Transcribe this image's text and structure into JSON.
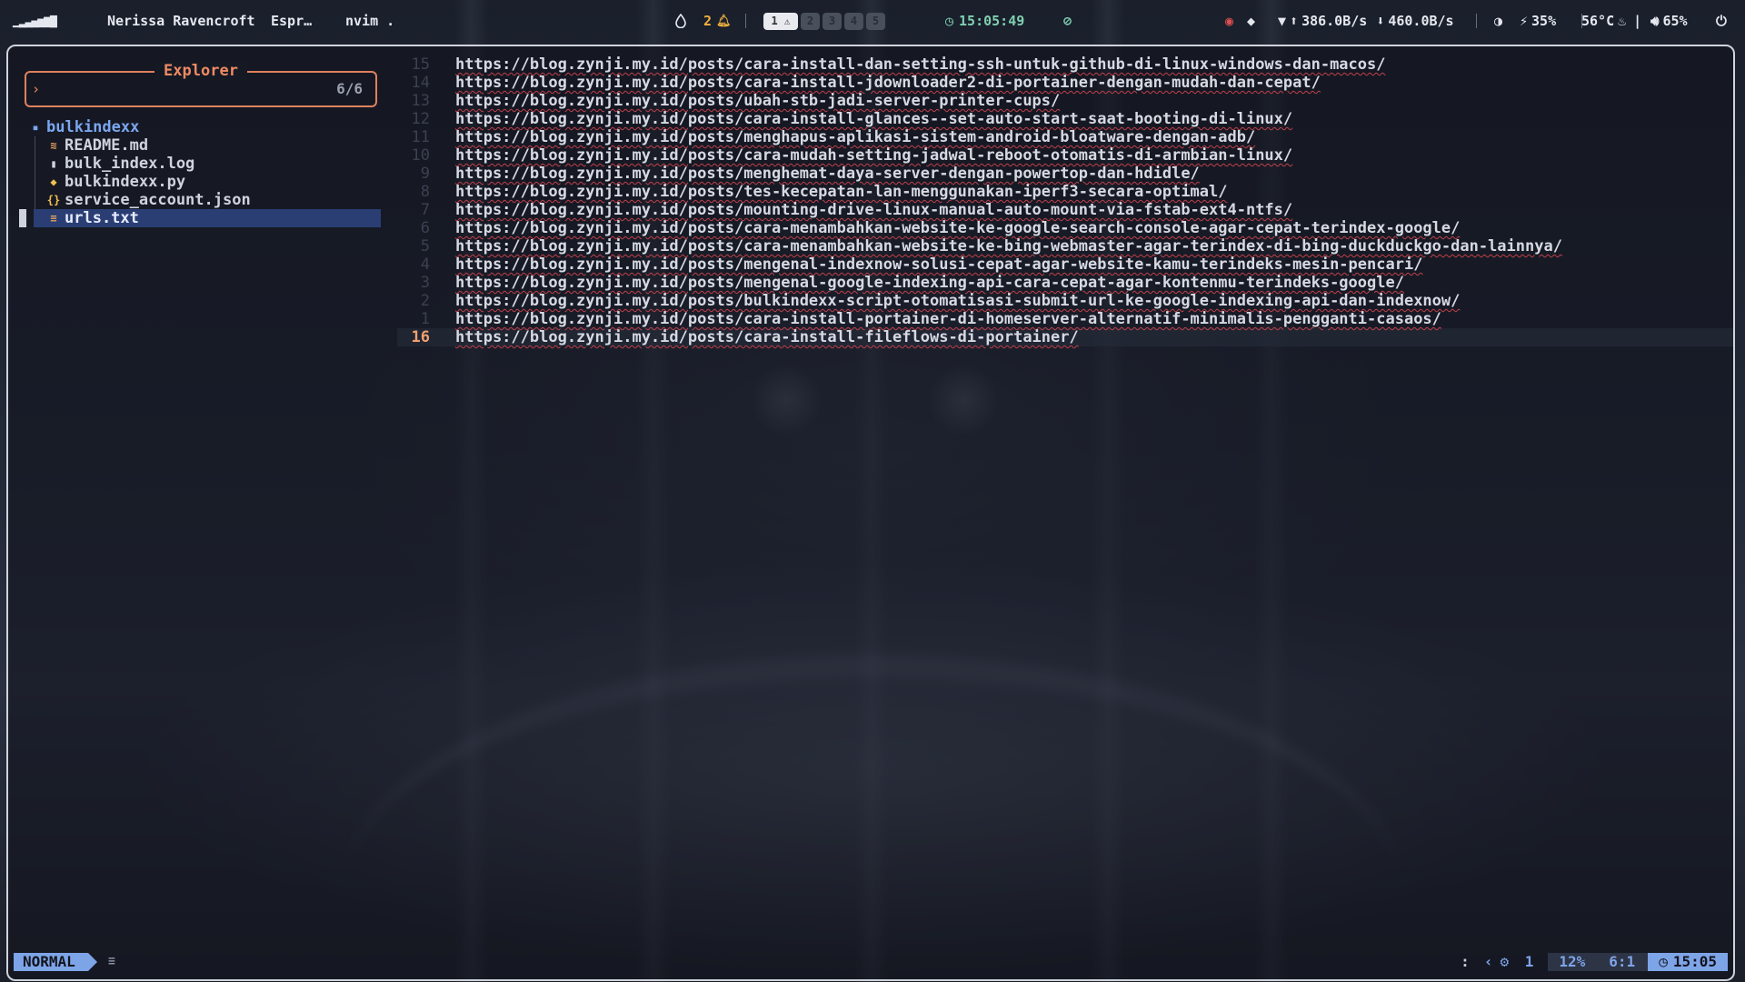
{
  "topbar": {
    "logo": "▁▂▃▄▅▆▇",
    "user": "Nerissa Ravencroft",
    "app_short": "Espr…",
    "window_title": "nvim .",
    "notifications": "2",
    "workspaces": [
      "1",
      "2",
      "3",
      "4",
      "5"
    ],
    "clock": "15:05:49",
    "net_up": "386.0B/s",
    "net_down": "460.0B/s",
    "brightness": "35%",
    "temperature": "56°C",
    "volume": "65%"
  },
  "explorer": {
    "title": "Explorer",
    "prompt": "›",
    "count": "6/6",
    "root": "bulkindexx",
    "files": [
      {
        "name": "README.md",
        "icon": "markdown-icon"
      },
      {
        "name": "bulk_index.log",
        "icon": "log-file-icon"
      },
      {
        "name": "bulkindexx.py",
        "icon": "python-icon"
      },
      {
        "name": "service_account.json",
        "icon": "json-icon"
      },
      {
        "name": "urls.txt",
        "icon": "text-file-icon"
      }
    ]
  },
  "editor": {
    "lines": [
      {
        "num": "15",
        "text": "https://blog.zynji.my.id/posts/cara-install-dan-setting-ssh-untuk-github-di-linux-windows-dan-macos/"
      },
      {
        "num": "14",
        "text": "https://blog.zynji.my.id/posts/cara-install-jdownloader2-di-portainer-dengan-mudah-dan-cepat/"
      },
      {
        "num": "13",
        "text": "https://blog.zynji.my.id/posts/ubah-stb-jadi-server-printer-cups/"
      },
      {
        "num": "12",
        "text": "https://blog.zynji.my.id/posts/cara-install-glances--set-auto-start-saat-booting-di-linux/"
      },
      {
        "num": "11",
        "text": "https://blog.zynji.my.id/posts/menghapus-aplikasi-sistem-android-bloatware-dengan-adb/"
      },
      {
        "num": "10",
        "text": "https://blog.zynji.my.id/posts/cara-mudah-setting-jadwal-reboot-otomatis-di-armbian-linux/"
      },
      {
        "num": "9",
        "text": "https://blog.zynji.my.id/posts/menghemat-daya-server-dengan-powertop-dan-hdidle/"
      },
      {
        "num": "8",
        "text": "https://blog.zynji.my.id/posts/tes-kecepatan-lan-menggunakan-iperf3-secara-optimal/"
      },
      {
        "num": "7",
        "text": "https://blog.zynji.my.id/posts/mounting-drive-linux-manual-auto-mount-via-fstab-ext4-ntfs/"
      },
      {
        "num": "6",
        "text": "https://blog.zynji.my.id/posts/cara-menambahkan-website-ke-google-search-console-agar-cepat-terindex-google/"
      },
      {
        "num": "5",
        "text": "https://blog.zynji.my.id/posts/cara-menambahkan-website-ke-bing-webmaster-agar-terindex-di-bing-duckduckgo-dan-lainnya/"
      },
      {
        "num": "4",
        "text": "https://blog.zynji.my.id/posts/mengenal-indexnow-solusi-cepat-agar-website-kamu-terindeks-mesin-pencari/"
      },
      {
        "num": "3",
        "text": "https://blog.zynji.my.id/posts/mengenal-google-indexing-api-cara-cepat-agar-kontenmu-terindeks-google/"
      },
      {
        "num": "2",
        "text": "https://blog.zynji.my.id/posts/bulkindexx-script-otomatisasi-submit-url-ke-google-indexing-api-dan-indexnow/"
      },
      {
        "num": "1",
        "text": "https://blog.zynji.my.id/posts/cara-install-portainer-di-homeserver-alternatif-minimalis-pengganti-casaos/"
      },
      {
        "num": "16",
        "text": "https://blog.zynji.my.id/posts/cara-install-fileflows-di-portainer/"
      }
    ]
  },
  "statusline": {
    "mode": "NORMAL",
    "cmd": ":",
    "diagnostics": "1",
    "percent": "12%",
    "position": "6:1",
    "time": "15:05"
  },
  "colors": {
    "accent": "#7ea4e8",
    "finder_border": "#e0805e",
    "current_line_number": "#f0a070",
    "selection": "#2a3e74"
  }
}
